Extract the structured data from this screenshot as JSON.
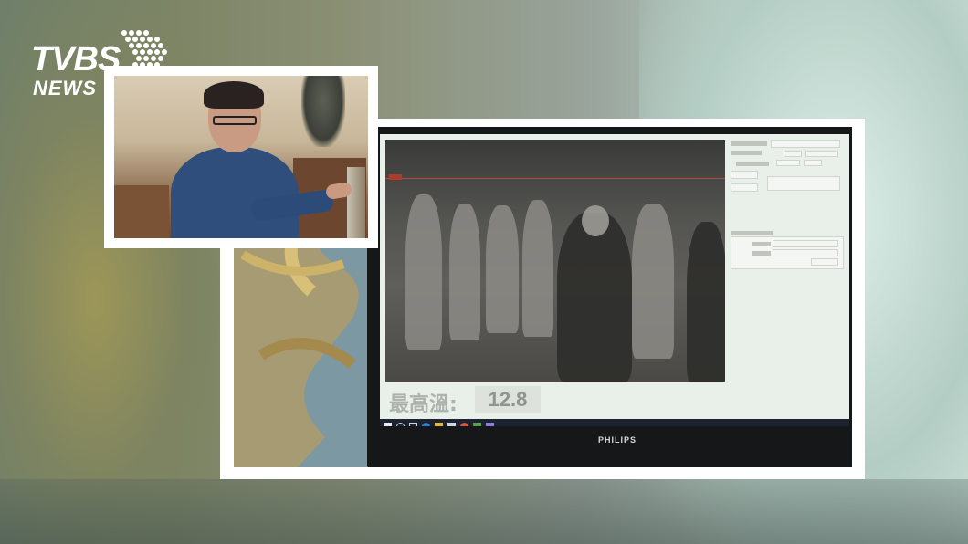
{
  "logo": {
    "brand": "TVBS",
    "sub": "NEWS"
  },
  "monitor": {
    "brand": "PHILIPS",
    "max_temp_label": "最高溫:",
    "max_temp_value": "12.8"
  },
  "colors": {
    "frame": "#ffffff",
    "thermal_bg": "#555552",
    "shirt": "#2f4e7c"
  }
}
